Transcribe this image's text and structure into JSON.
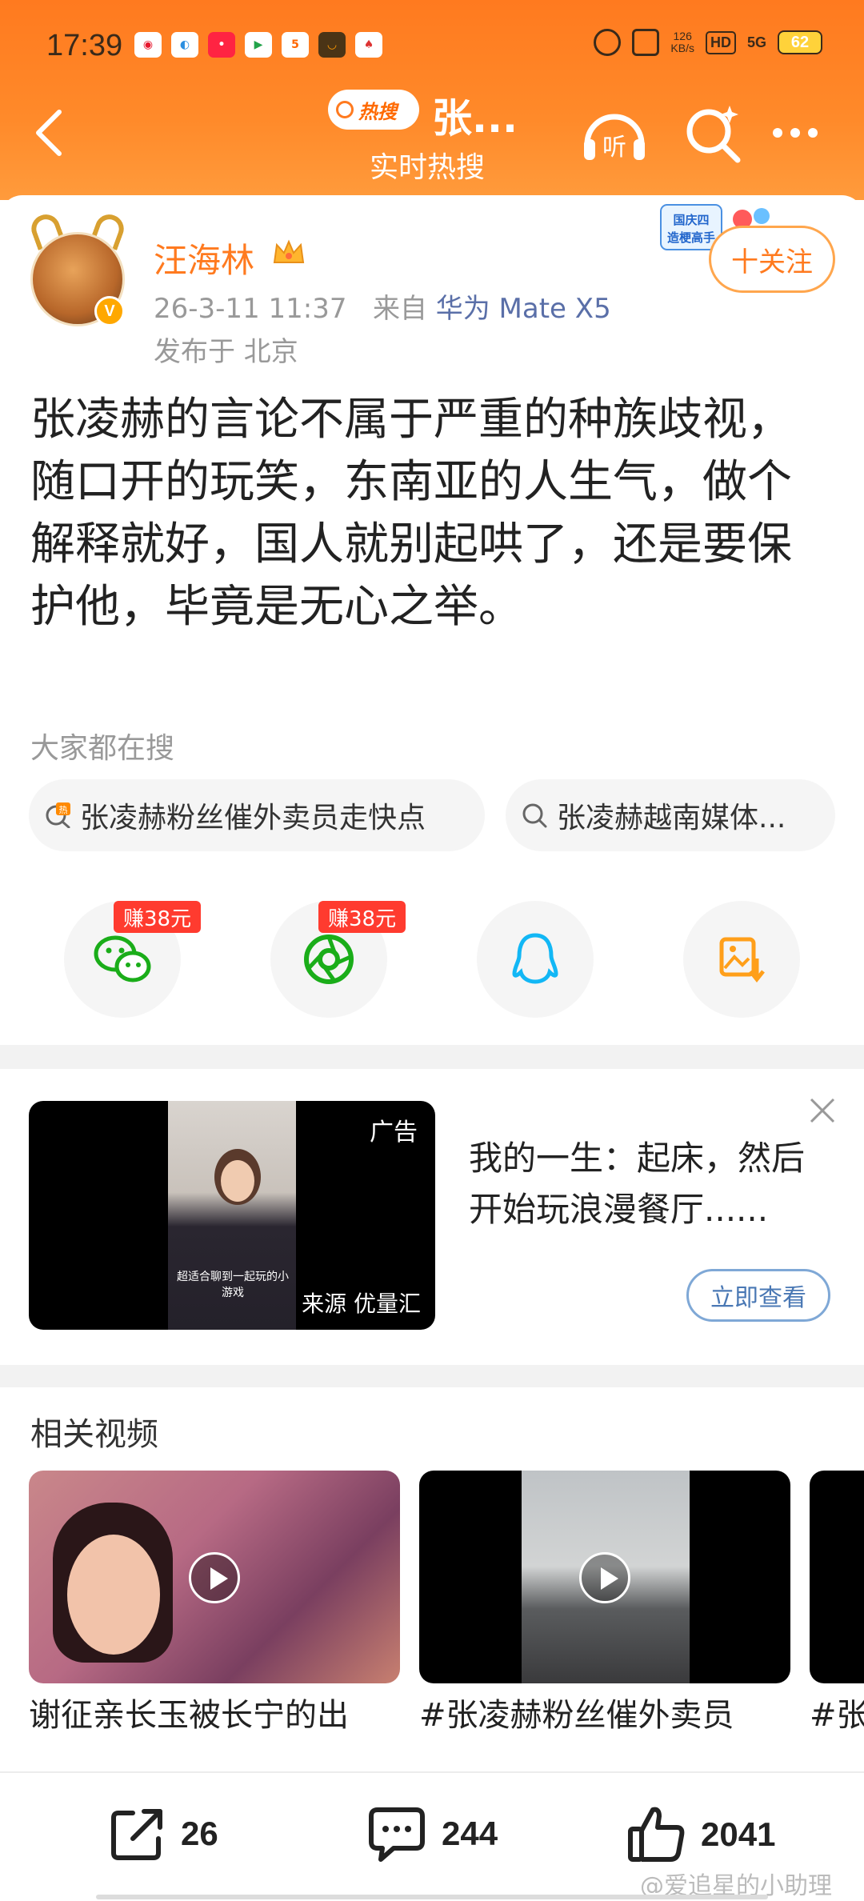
{
  "status_bar": {
    "time": "17:39",
    "network_speed_value": "126",
    "network_speed_unit": "KB/s",
    "hd": "HD",
    "signal": "5G",
    "battery": "62"
  },
  "nav": {
    "hot_pill": "热搜",
    "topic": "张...",
    "subtitle": "实时热搜",
    "listen_label": "听"
  },
  "post": {
    "username": "汪海林",
    "timestamp": "26-3-11 11:37",
    "source_prefix": "来自",
    "device": "华为 Mate X5",
    "location": "发布于 北京",
    "follow": "十关注",
    "badge_line1": "国庆四",
    "badge_line2": "造梗高手",
    "text": "张凌赫的言论不属于严重的种族歧视，随口开的玩笑，东南亚的人生气，做个解释就好，国人就别起哄了，还是要保护他，毕竟是无心之举。"
  },
  "search": {
    "label": "大家都在搜",
    "chips": [
      "张凌赫粉丝催外卖员走快点",
      "张凌赫越南媒体..."
    ],
    "hot_tag": "热"
  },
  "share": {
    "earn1": "赚38元",
    "earn2": "赚38元"
  },
  "ad": {
    "label": "广告",
    "caption": "超适合聊到一起玩的小游戏",
    "source": "来源 优量汇",
    "text": "我的一生：起床，然后开始玩浪漫餐厅......",
    "button": "立即查看"
  },
  "related": {
    "title": "相关视频",
    "videos": [
      {
        "caption": "谢征亲长玉被长宁的出"
      },
      {
        "caption": "#张凌赫粉丝催外卖员"
      },
      {
        "caption": "#张"
      }
    ]
  },
  "bottom": {
    "reposts": "26",
    "comments": "244",
    "likes": "2041",
    "watermark": "@爱追星的小助理"
  },
  "colors": {
    "accent": "#ff7a1f",
    "device_link": "#5a6fa8",
    "ad_button": "#4a78b4"
  }
}
